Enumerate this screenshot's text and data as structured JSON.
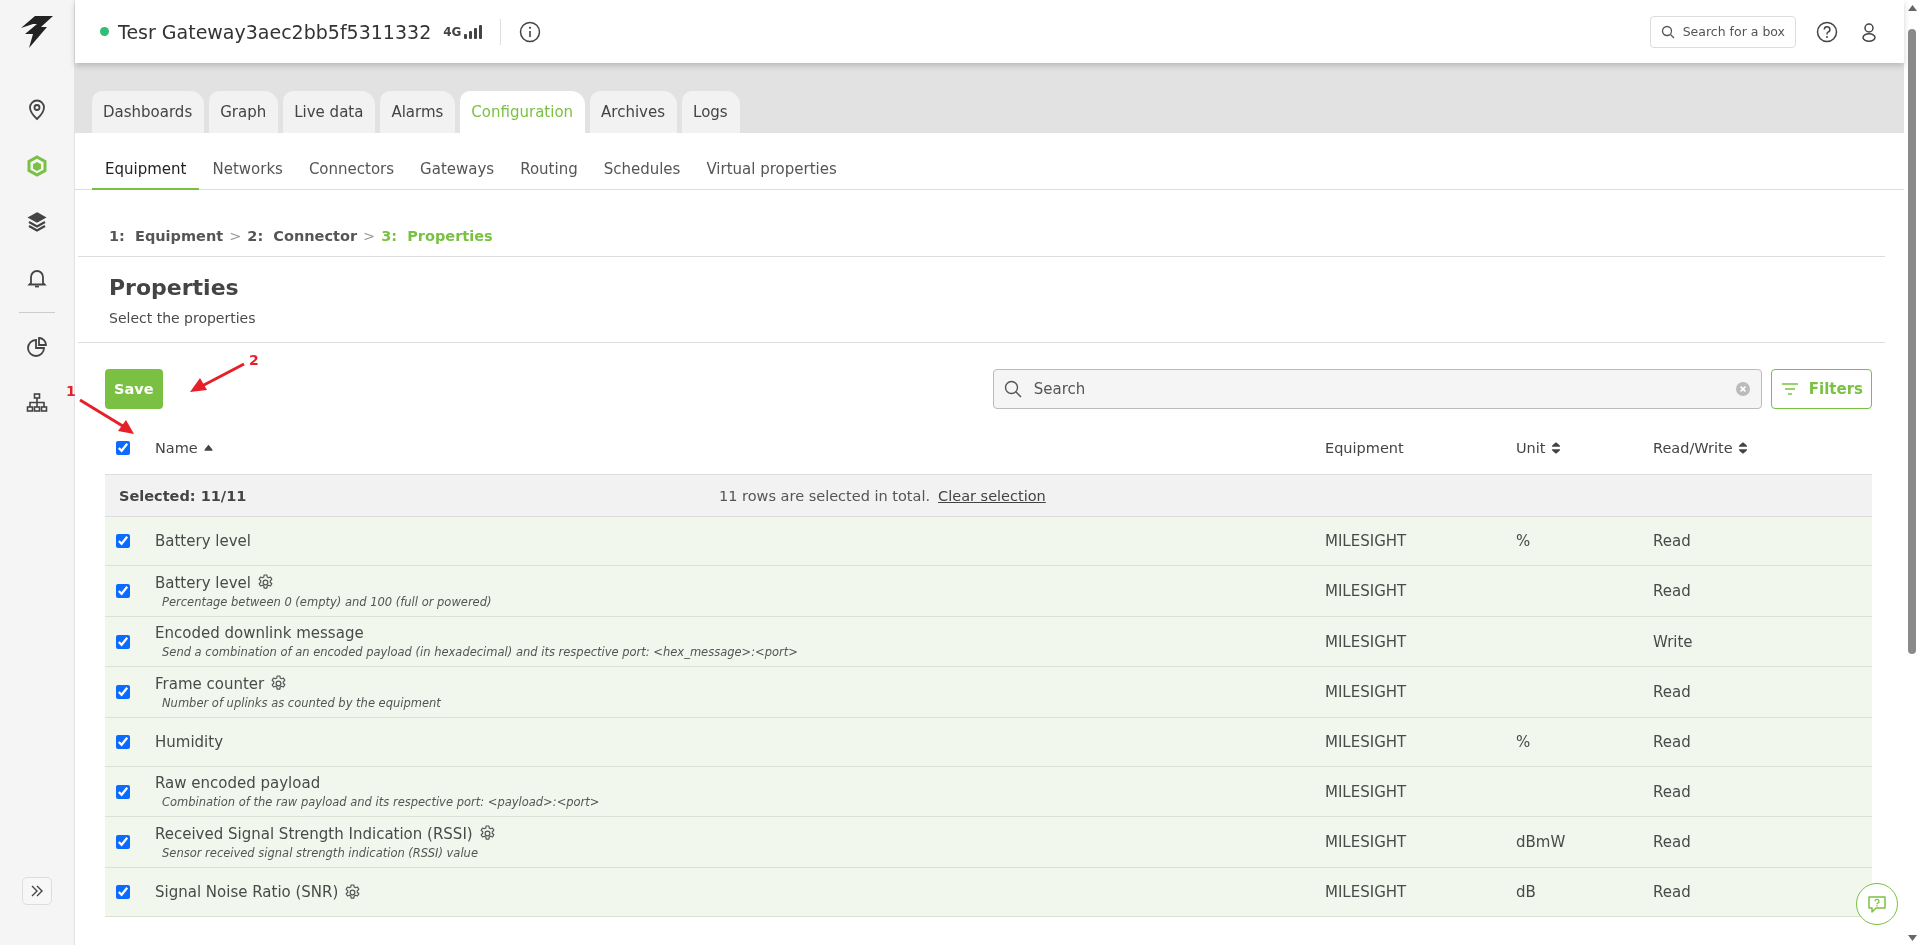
{
  "sidebar": {
    "items": [
      {
        "selected": false
      },
      {
        "selected": true
      },
      {
        "selected": false
      },
      {
        "selected": false
      },
      {
        "selected": false
      },
      {
        "selected": false
      }
    ]
  },
  "header": {
    "title": "Tesr Gateway3aec2bb5f5311332",
    "online": true,
    "network": "4G",
    "search_placeholder": "Search for a box"
  },
  "tabs": [
    {
      "label": "Dashboards",
      "selected": false
    },
    {
      "label": "Graph",
      "selected": false
    },
    {
      "label": "Live data",
      "selected": false
    },
    {
      "label": "Alarms",
      "selected": false
    },
    {
      "label": "Configuration",
      "selected": true
    },
    {
      "label": "Archives",
      "selected": false
    },
    {
      "label": "Logs",
      "selected": false
    }
  ],
  "subtabs": [
    {
      "label": "Equipment",
      "selected": true
    },
    {
      "label": "Networks",
      "selected": false
    },
    {
      "label": "Connectors",
      "selected": false
    },
    {
      "label": "Gateways",
      "selected": false
    },
    {
      "label": "Routing",
      "selected": false
    },
    {
      "label": "Schedules",
      "selected": false
    },
    {
      "label": "Virtual properties",
      "selected": false
    }
  ],
  "breadcrumb": {
    "separator": ">",
    "steps": [
      {
        "number": "1:",
        "label": "Equipment",
        "selected": false
      },
      {
        "number": "2:",
        "label": "Connector",
        "selected": false
      },
      {
        "number": "3:",
        "label": "Properties",
        "selected": true
      }
    ]
  },
  "section": {
    "title": "Properties",
    "subtitle": "Select the properties"
  },
  "toolbar": {
    "save": "Save",
    "search_placeholder": "Search",
    "filters": "Filters"
  },
  "table": {
    "all_checked": true,
    "columns": [
      {
        "label": "Name",
        "sortable": true,
        "sorted": true
      },
      {
        "label": "Equipment",
        "sortable": false
      },
      {
        "label": "Unit",
        "sortable": true,
        "sorted": false
      },
      {
        "label": "Read/Write",
        "sortable": true,
        "sorted": false
      }
    ],
    "selection_bar": {
      "count": "Selected: 11/11",
      "message": "11 rows are selected in total.",
      "clear_link": "Clear selection"
    },
    "rows": [
      {
        "checked": true,
        "name": "Battery level",
        "has_settings": false,
        "equipment": "MILESIGHT",
        "unit": "%",
        "access": "Read"
      },
      {
        "checked": true,
        "name": "Battery level",
        "has_settings": true,
        "description": "Percentage between 0 (empty) and 100 (full or powered)",
        "equipment": "MILESIGHT",
        "access": "Read"
      },
      {
        "checked": true,
        "name": "Encoded downlink message",
        "has_settings": false,
        "description": "Send a combination of an encoded payload (in hexadecimal) and its respective port: <hex_message>:<port>",
        "equipment": "MILESIGHT",
        "access": "Write"
      },
      {
        "checked": true,
        "name": "Frame counter",
        "has_settings": true,
        "description": "Number of uplinks as counted by the equipment",
        "equipment": "MILESIGHT",
        "access": "Read"
      },
      {
        "checked": true,
        "name": "Humidity",
        "has_settings": false,
        "equipment": "MILESIGHT",
        "unit": "%",
        "access": "Read"
      },
      {
        "checked": true,
        "name": "Raw encoded payload",
        "has_settings": false,
        "description": "Combination of the raw payload and its respective port: <payload>:<port>",
        "equipment": "MILESIGHT",
        "access": "Read"
      },
      {
        "checked": true,
        "name": "Received Signal Strength Indication (RSSI)",
        "has_settings": true,
        "description": "Sensor received signal strength indication (RSSI) value",
        "equipment": "MILESIGHT",
        "unit": "dBmW",
        "access": "Read"
      },
      {
        "checked": true,
        "name": "Signal Noise Ratio (SNR)",
        "has_settings": true,
        "equipment": "MILESIGHT",
        "unit": "dB",
        "access": "Read"
      }
    ]
  },
  "annotations": [
    {
      "label": "1"
    },
    {
      "label": "2"
    }
  ]
}
